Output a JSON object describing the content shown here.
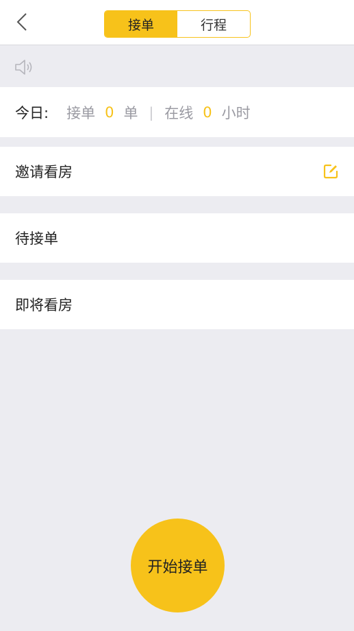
{
  "header": {
    "tabs": [
      {
        "label": "接单",
        "active": true
      },
      {
        "label": "行程",
        "active": false
      }
    ]
  },
  "stats": {
    "today_label": "今日:",
    "orders_label": "接单",
    "orders_count": "0",
    "orders_unit": "单",
    "separator": "|",
    "online_label": "在线",
    "online_count": "0",
    "online_unit": "小时"
  },
  "rows": [
    {
      "label": "邀请看房",
      "icon": "edit-icon"
    },
    {
      "label": "待接单"
    },
    {
      "label": "即将看房"
    }
  ],
  "start_button": {
    "label": "开始接单"
  },
  "colors": {
    "accent": "#f7c21a",
    "background": "#ececf1",
    "muted": "#9a9aa2"
  }
}
